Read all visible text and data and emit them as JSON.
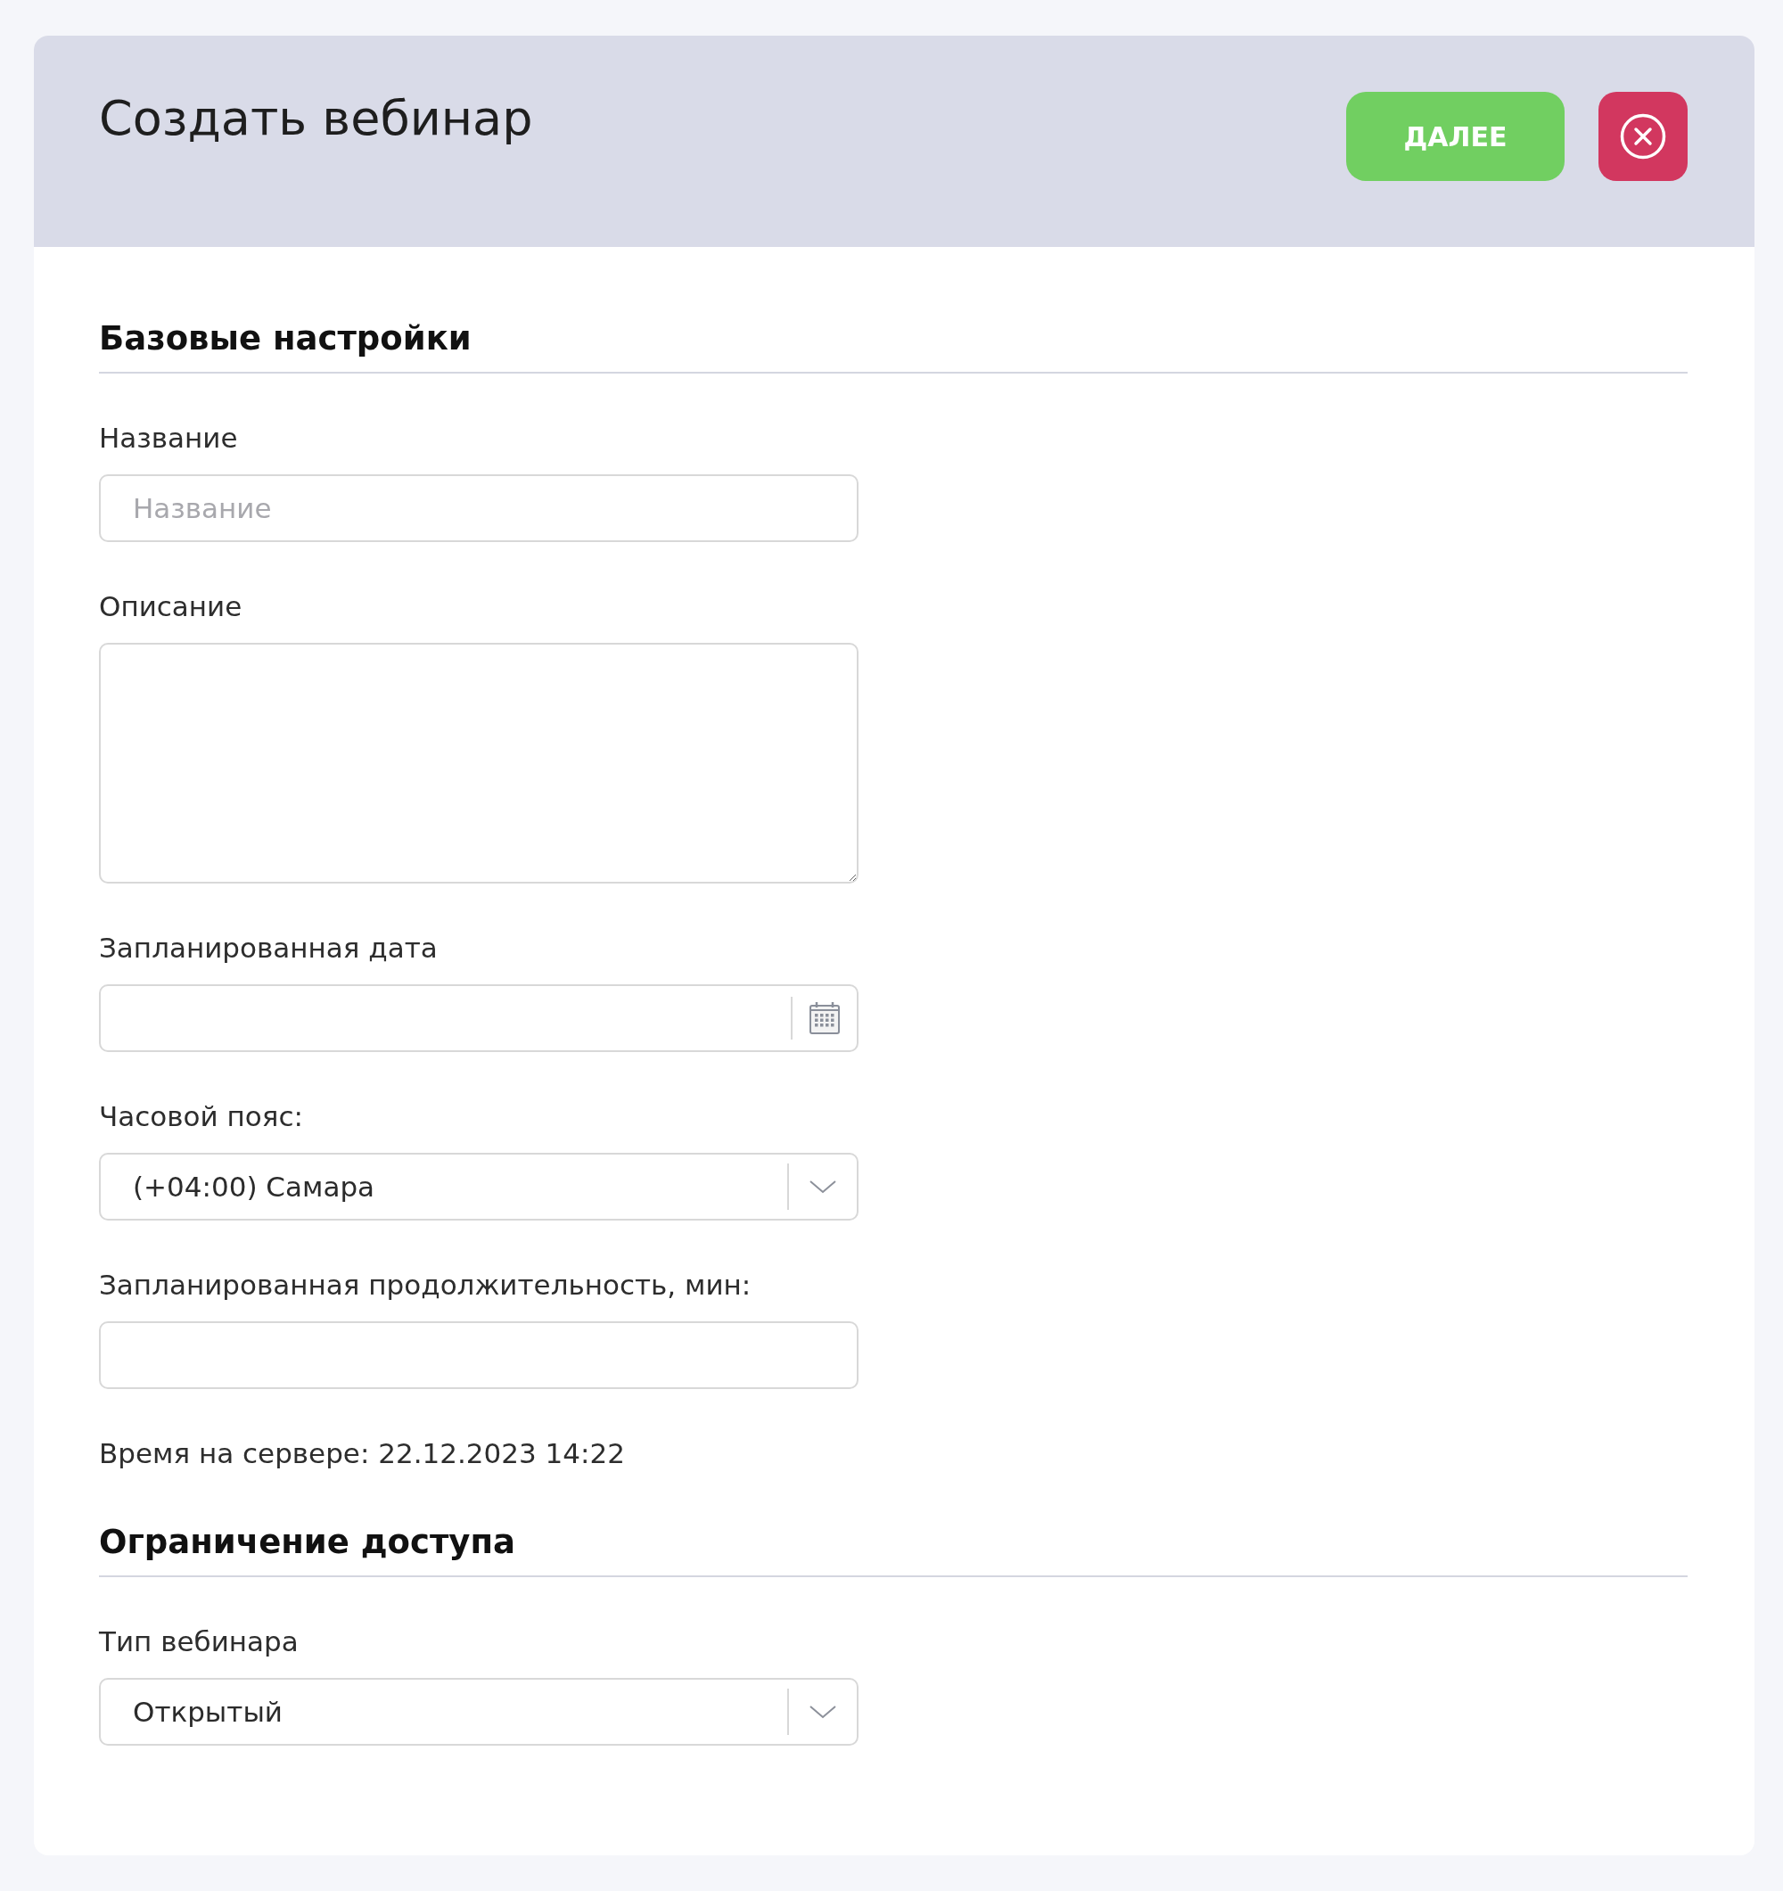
{
  "header": {
    "title": "Создать вебинар",
    "next_button": "ДАЛЕЕ"
  },
  "sections": [
    {
      "title": "Базовые настройки",
      "fields": [
        {
          "kind": "text",
          "label": "Название",
          "placeholder": "Название"
        },
        {
          "kind": "textarea",
          "label": "Описание"
        },
        {
          "kind": "date",
          "label": "Запланированная дата"
        },
        {
          "kind": "select",
          "label": "Часовой пояс:",
          "value": "(+04:00) Самара"
        },
        {
          "kind": "text",
          "label": "Запланированная продолжительность, мин:"
        },
        {
          "kind": "note",
          "text": "Время на сервере: 22.12.2023 14:22"
        }
      ]
    },
    {
      "title": "Ограничение доступа",
      "fields": [
        {
          "kind": "select",
          "label": "Тип вебинара",
          "value": "Открытый"
        }
      ]
    }
  ]
}
